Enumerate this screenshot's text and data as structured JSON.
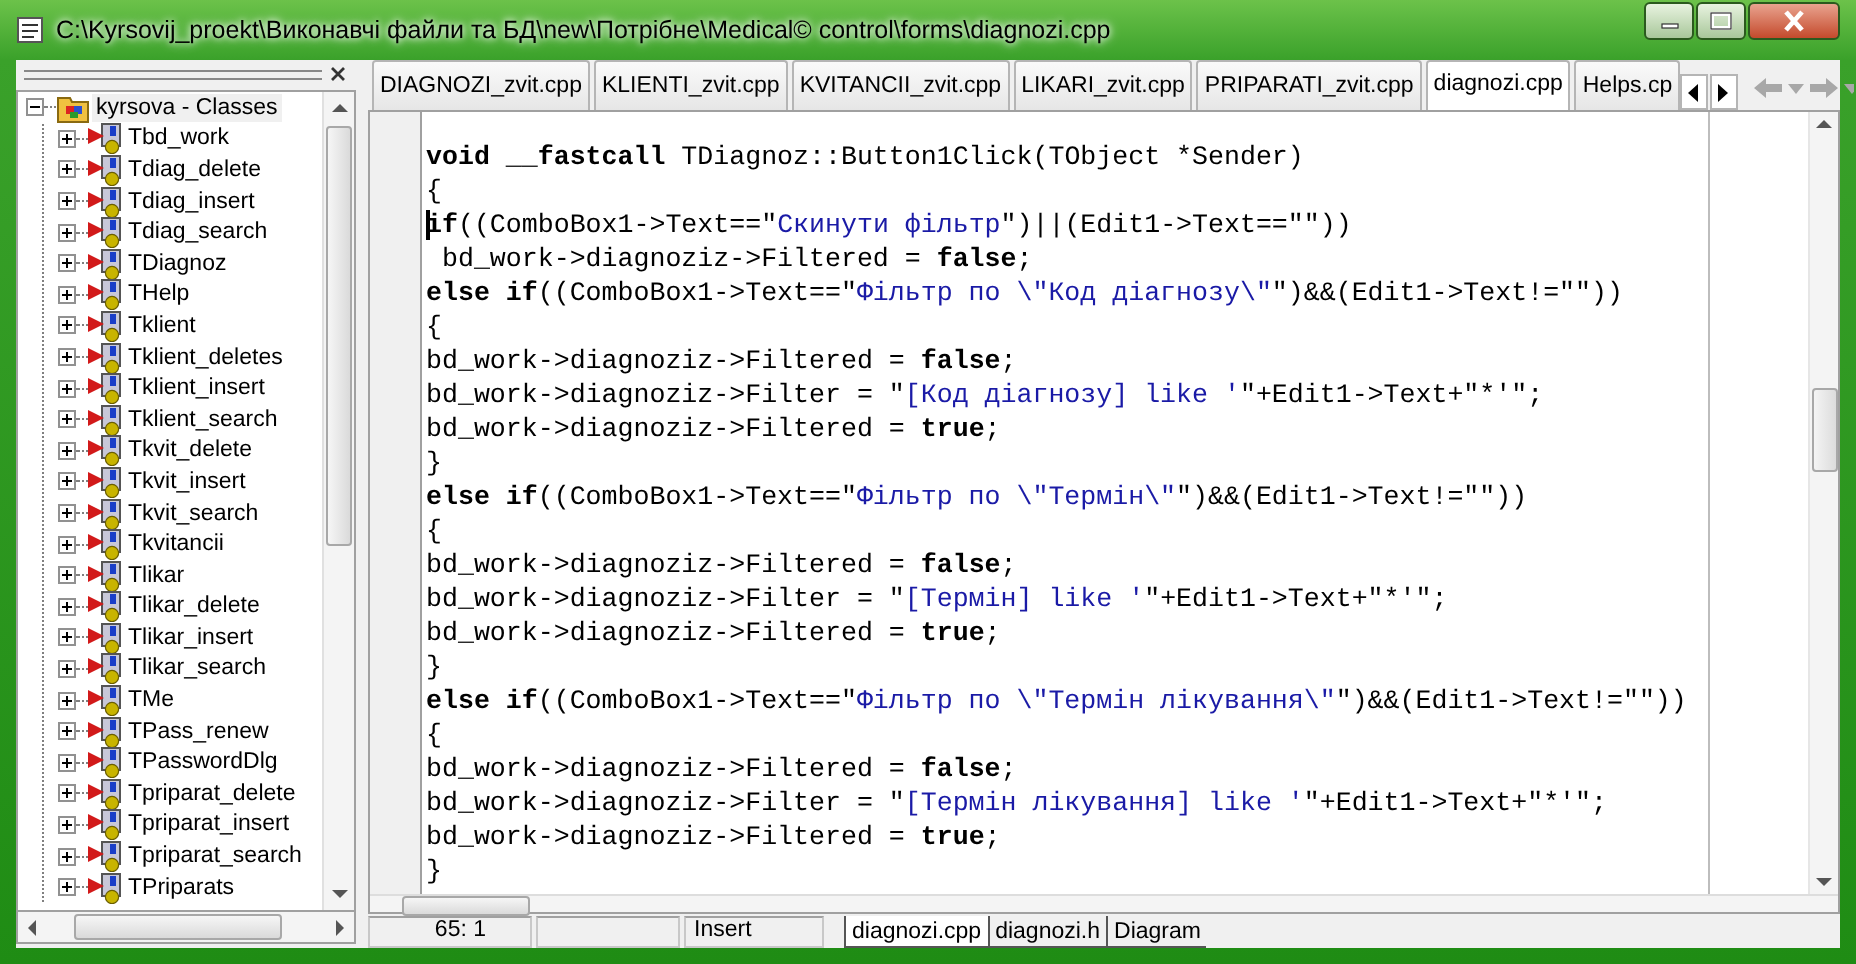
{
  "window": {
    "title": "C:\\Kyrsovij_proekt\\Виконавчі файли та БД\\new\\Потрібне\\Medical© control\\forms\\diagnozi.cpp"
  },
  "class_tree": {
    "label": "kyrsova - Classes",
    "expanded": true,
    "children": [
      {
        "label": "Tbd_work",
        "expanded": false
      },
      {
        "label": "Tdiag_delete",
        "expanded": false
      },
      {
        "label": "Tdiag_insert",
        "expanded": false
      },
      {
        "label": "Tdiag_search",
        "expanded": false
      },
      {
        "label": "TDiagnoz",
        "expanded": false
      },
      {
        "label": "THelp",
        "expanded": false
      },
      {
        "label": "Tklient",
        "expanded": false
      },
      {
        "label": "Tklient_deletes",
        "expanded": false
      },
      {
        "label": "Tklient_insert",
        "expanded": false
      },
      {
        "label": "Tklient_search",
        "expanded": false
      },
      {
        "label": "Tkvit_delete",
        "expanded": false
      },
      {
        "label": "Tkvit_insert",
        "expanded": false
      },
      {
        "label": "Tkvit_search",
        "expanded": false
      },
      {
        "label": "Tkvitancii",
        "expanded": false
      },
      {
        "label": "Tlikar",
        "expanded": false
      },
      {
        "label": "Tlikar_delete",
        "expanded": false
      },
      {
        "label": "Tlikar_insert",
        "expanded": false
      },
      {
        "label": "Tlikar_search",
        "expanded": false
      },
      {
        "label": "TMe",
        "expanded": false
      },
      {
        "label": "TPass_renew",
        "expanded": false
      },
      {
        "label": "TPasswordDlg",
        "expanded": false
      },
      {
        "label": "Tpriparat_delete",
        "expanded": false
      },
      {
        "label": "Tpriparat_insert",
        "expanded": false
      },
      {
        "label": "Tpriparat_search",
        "expanded": false
      },
      {
        "label": "TPriparats",
        "expanded": false
      }
    ]
  },
  "editor_tabs": [
    {
      "label": "DIAGNOZI_zvit.cpp",
      "selected": false
    },
    {
      "label": "KLIENTI_zvit.cpp",
      "selected": false
    },
    {
      "label": "KVITANCII_zvit.cpp",
      "selected": false
    },
    {
      "label": "LIKARI_zvit.cpp",
      "selected": false
    },
    {
      "label": "PRIPARATI_zvit.cpp",
      "selected": false
    },
    {
      "label": "diagnozi.cpp",
      "selected": true
    },
    {
      "label": "Helps.cp",
      "selected": false
    }
  ],
  "code_lines": [
    [
      {
        "kind": "keyword",
        "text": "void __fastcall"
      },
      {
        "kind": "plain",
        "text": " TDiagnoz::Button1Click(TObject *Sender)"
      }
    ],
    [
      {
        "kind": "plain",
        "text": "{"
      }
    ],
    [
      {
        "kind": "keyword",
        "text": "if"
      },
      {
        "kind": "plain",
        "text": "((ComboBox1->Text==\""
      },
      {
        "kind": "string",
        "text": "Скинути фільтр"
      },
      {
        "kind": "plain",
        "text": "\")||(Edit1->Text==\"\"))"
      }
    ],
    [
      {
        "kind": "plain",
        "text": " bd_work->diagnoziz->Filtered = "
      },
      {
        "kind": "keyword",
        "text": "false"
      },
      {
        "kind": "plain",
        "text": ";"
      }
    ],
    [
      {
        "kind": "keyword",
        "text": "else if"
      },
      {
        "kind": "plain",
        "text": "((ComboBox1->Text==\""
      },
      {
        "kind": "string",
        "text": "Фільтр по \\\"Код діагнозу\\\""
      },
      {
        "kind": "plain",
        "text": "\")&&(Edit1->Text!=\"\"))"
      }
    ],
    [
      {
        "kind": "plain",
        "text": "{"
      }
    ],
    [
      {
        "kind": "plain",
        "text": "bd_work->diagnoziz->Filtered = "
      },
      {
        "kind": "keyword",
        "text": "false"
      },
      {
        "kind": "plain",
        "text": ";"
      }
    ],
    [
      {
        "kind": "plain",
        "text": "bd_work->diagnoziz->Filter = \""
      },
      {
        "kind": "string",
        "text": "[Код діагнозу] like '"
      },
      {
        "kind": "plain",
        "text": "\"+Edit1->Text+\"*'\";"
      }
    ],
    [
      {
        "kind": "plain",
        "text": "bd_work->diagnoziz->Filtered = "
      },
      {
        "kind": "keyword",
        "text": "true"
      },
      {
        "kind": "plain",
        "text": ";"
      }
    ],
    [
      {
        "kind": "plain",
        "text": "}"
      }
    ],
    [
      {
        "kind": "keyword",
        "text": "else if"
      },
      {
        "kind": "plain",
        "text": "((ComboBox1->Text==\""
      },
      {
        "kind": "string",
        "text": "Фільтр по \\\"Термін\\\""
      },
      {
        "kind": "plain",
        "text": "\")&&(Edit1->Text!=\"\"))"
      }
    ],
    [
      {
        "kind": "plain",
        "text": "{"
      }
    ],
    [
      {
        "kind": "plain",
        "text": "bd_work->diagnoziz->Filtered = "
      },
      {
        "kind": "keyword",
        "text": "false"
      },
      {
        "kind": "plain",
        "text": ";"
      }
    ],
    [
      {
        "kind": "plain",
        "text": "bd_work->diagnoziz->Filter = \""
      },
      {
        "kind": "string",
        "text": "[Термін] like '"
      },
      {
        "kind": "plain",
        "text": "\"+Edit1->Text+\"*'\";"
      }
    ],
    [
      {
        "kind": "plain",
        "text": "bd_work->diagnoziz->Filtered = "
      },
      {
        "kind": "keyword",
        "text": "true"
      },
      {
        "kind": "plain",
        "text": ";"
      }
    ],
    [
      {
        "kind": "plain",
        "text": "}"
      }
    ],
    [
      {
        "kind": "keyword",
        "text": "else if"
      },
      {
        "kind": "plain",
        "text": "((ComboBox1->Text==\""
      },
      {
        "kind": "string",
        "text": "Фільтр по \\\"Термін лікування\\\""
      },
      {
        "kind": "plain",
        "text": "\")&&(Edit1->Text!=\"\"))"
      }
    ],
    [
      {
        "kind": "plain",
        "text": "{"
      }
    ],
    [
      {
        "kind": "plain",
        "text": "bd_work->diagnoziz->Filtered = "
      },
      {
        "kind": "keyword",
        "text": "false"
      },
      {
        "kind": "plain",
        "text": ";"
      }
    ],
    [
      {
        "kind": "plain",
        "text": "bd_work->diagnoziz->Filter = \""
      },
      {
        "kind": "string",
        "text": "[Термін лікування] like '"
      },
      {
        "kind": "plain",
        "text": "\"+Edit1->Text+\"*'\";"
      }
    ],
    [
      {
        "kind": "plain",
        "text": "bd_work->diagnoziz->Filtered = "
      },
      {
        "kind": "keyword",
        "text": "true"
      },
      {
        "kind": "plain",
        "text": ";"
      }
    ],
    [
      {
        "kind": "plain",
        "text": "}"
      }
    ]
  ],
  "status_bar": {
    "position": "65:  1",
    "mode": "Insert"
  },
  "file_tabs": [
    {
      "label": "diagnozi.cpp",
      "selected": true
    },
    {
      "label": "diagnozi.h",
      "selected": false
    },
    {
      "label": "Diagram",
      "selected": false
    }
  ]
}
